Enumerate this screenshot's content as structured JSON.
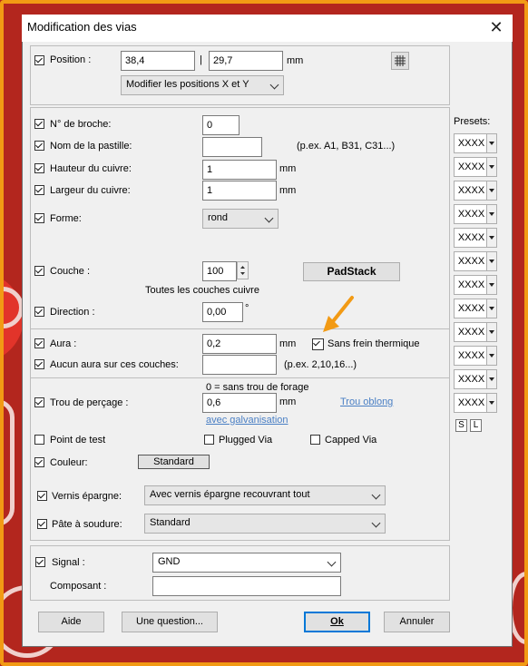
{
  "window": {
    "title": "Modification des vias",
    "close_icon": "close-icon"
  },
  "position": {
    "label": "Position :",
    "x": "38,4",
    "separator": "|",
    "y": "29,7",
    "unit": "mm",
    "mode_select": "Modifier les positions X et Y",
    "grid_icon": "grid-icon"
  },
  "pad": {
    "pin_label": "N° de broche:",
    "pin_value": "0",
    "name_label": "Nom de la pastille:",
    "name_value": "",
    "name_hint": "(p.ex. A1, B31, C31...)",
    "height_label": "Hauteur du cuivre:",
    "height_value": "1",
    "height_unit": "mm",
    "width_label": "Largeur du cuivre:",
    "width_value": "1",
    "width_unit": "mm",
    "shape_label": "Forme:",
    "shape_value": "rond",
    "layer_label": "Couche :",
    "layer_value": "100",
    "layer_hint": "Toutes les couches cuivre",
    "padstack_button": "PadStack",
    "direction_label": "Direction :",
    "direction_value": "0,00",
    "direction_unit": "°"
  },
  "aura": {
    "label": "Aura :",
    "value": "0,2",
    "unit": "mm",
    "no_thermal_label": "Sans frein thermique",
    "no_aura_layers_label": "Aucun aura sur ces couches:",
    "no_aura_layers_value": "",
    "no_aura_layers_hint": "(p.ex. 2,10,16...)"
  },
  "drill": {
    "hint": "0 = sans trou de forage",
    "label": "Trou de perçage :",
    "value": "0,6",
    "unit": "mm",
    "oblong_link": "Trou oblong",
    "plating_link": "avec galvanisation"
  },
  "options": {
    "test_point_label": "Point de test",
    "plugged_via_label": "Plugged Via",
    "capped_via_label": "Capped Via",
    "color_label": "Couleur:",
    "color_button": "Standard",
    "solder_mask_label": "Vernis épargne:",
    "solder_mask_value": "Avec vernis épargne recouvrant tout",
    "paste_label": "Pâte à soudure:",
    "paste_value": "Standard"
  },
  "signal": {
    "label": "Signal :",
    "value": "GND",
    "component_label": "Composant :",
    "component_value": ""
  },
  "presets": {
    "title": "Presets:",
    "items": [
      "XXXX",
      "XXXX",
      "XXXX",
      "XXXX",
      "XXXX",
      "XXXX",
      "XXXX",
      "XXXX",
      "XXXX",
      "XXXX",
      "XXXX",
      "XXXX"
    ],
    "s_label": "S",
    "l_label": "L"
  },
  "buttons": {
    "help": "Aide",
    "question": "Une question...",
    "ok": "Ok",
    "cancel": "Annuler"
  },
  "annotation": {
    "arrow_color": "#f29a14"
  },
  "colors": {
    "background": "#b3261e",
    "frame": "#f29a14",
    "link": "#4a7fc4",
    "default_button_border": "#0078d7"
  }
}
